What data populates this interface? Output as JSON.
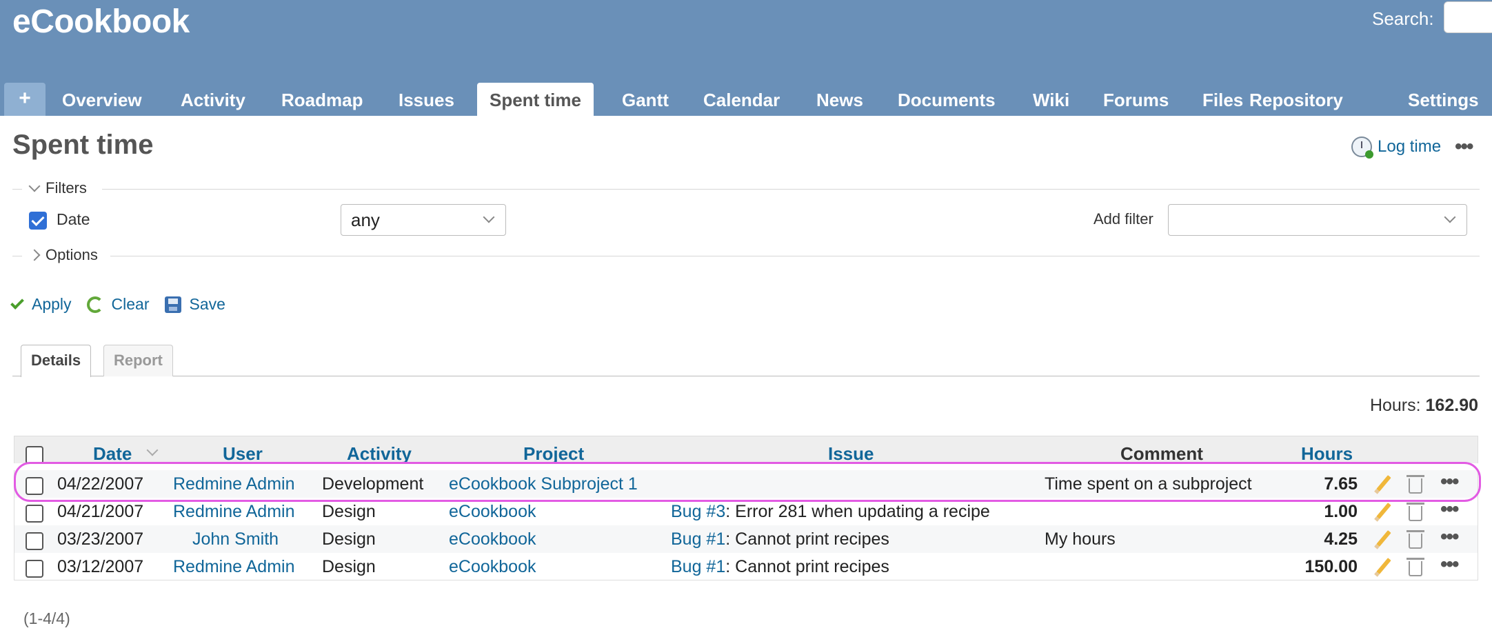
{
  "header": {
    "app_title": "eCookbook",
    "search_label": "Search:",
    "new_label": "+"
  },
  "menu": {
    "tabs": [
      {
        "label": "Overview"
      },
      {
        "label": "Activity"
      },
      {
        "label": "Roadmap"
      },
      {
        "label": "Issues"
      },
      {
        "label": "Spent time",
        "selected": true
      },
      {
        "label": "Gantt"
      },
      {
        "label": "Calendar"
      },
      {
        "label": "News"
      },
      {
        "label": "Documents"
      },
      {
        "label": "Wiki"
      },
      {
        "label": "Forums"
      },
      {
        "label": "Files"
      },
      {
        "label": "Repository"
      },
      {
        "label": "Settings"
      }
    ]
  },
  "page": {
    "title": "Spent time",
    "log_time_label": "Log time",
    "more_label": "•••"
  },
  "filters": {
    "legend": "Filters",
    "date_label": "Date",
    "date_checked": true,
    "date_operator": "any",
    "add_filter_label": "Add filter",
    "add_filter_value": ""
  },
  "options": {
    "legend": "Options"
  },
  "actions": {
    "apply": "Apply",
    "clear": "Clear",
    "save": "Save"
  },
  "tabs": {
    "details": "Details",
    "report": "Report"
  },
  "totals": {
    "hours_label": "Hours:",
    "hours_value": "162.90"
  },
  "table": {
    "columns": [
      "Date",
      "User",
      "Activity",
      "Project",
      "Issue",
      "Comment",
      "Hours"
    ],
    "rows": [
      {
        "date": "04/22/2007",
        "user": "Redmine Admin",
        "activity": "Development",
        "project": "eCookbook Subproject 1",
        "issue_ref": "",
        "issue_subject": "",
        "comment": "Time spent on a subproject",
        "hours": "7.65"
      },
      {
        "date": "04/21/2007",
        "user": "Redmine Admin",
        "activity": "Design",
        "project": "eCookbook",
        "issue_ref": "Bug #3",
        "issue_subject": ": Error 281 when updating a recipe",
        "comment": "",
        "hours": "1.00"
      },
      {
        "date": "03/23/2007",
        "user": "John Smith",
        "activity": "Design",
        "project": "eCookbook",
        "issue_ref": "Bug #1",
        "issue_subject": ": Cannot print recipes",
        "comment": "My hours",
        "hours": "4.25"
      },
      {
        "date": "03/12/2007",
        "user": "Redmine Admin",
        "activity": "Design",
        "project": "eCookbook",
        "issue_ref": "Bug #1",
        "issue_subject": ": Cannot print recipes",
        "comment": "",
        "hours": "150.00"
      }
    ],
    "row_more_label": "•••"
  },
  "pagination": {
    "label": "(1-4/4)"
  },
  "colors": {
    "header_bg": "#6a90b8",
    "link": "#116699",
    "highlight": "#e25be3"
  }
}
